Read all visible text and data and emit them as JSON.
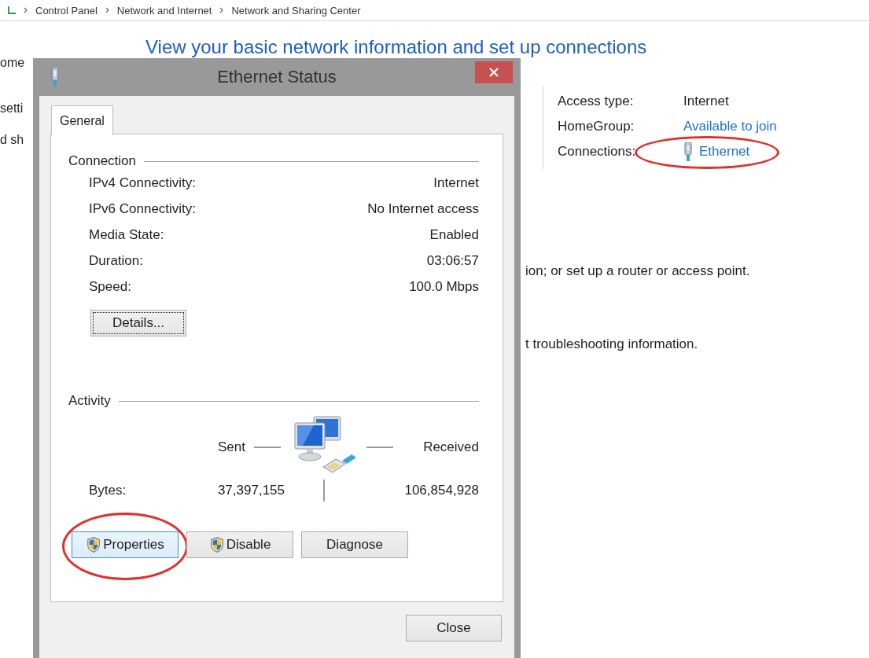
{
  "breadcrumb": [
    "Control Panel",
    "Network and Internet",
    "Network and Sharing Center"
  ],
  "page": {
    "heading": "View your basic network information and set up connections",
    "sidebar_fragments": [
      "ome",
      "setti",
      "d sh"
    ],
    "info": [
      {
        "label": "Access type:",
        "value": "Internet",
        "kind": "text",
        "highlighted": false
      },
      {
        "label": "HomeGroup:",
        "value": "Available to join",
        "kind": "link",
        "highlighted": false
      },
      {
        "label": "Connections:",
        "value": "Ethernet",
        "kind": "connection",
        "highlighted": true
      }
    ],
    "fragments": [
      "ion; or set up a router or access point.",
      "t troubleshooting information."
    ]
  },
  "dialog": {
    "title": "Ethernet Status",
    "tabs": [
      {
        "label": "General",
        "selected": true
      }
    ],
    "connection": {
      "title": "Connection",
      "rows": [
        {
          "label": "IPv4 Connectivity:",
          "value": "Internet"
        },
        {
          "label": "IPv6 Connectivity:",
          "value": "No Internet access"
        },
        {
          "label": "Media State:",
          "value": "Enabled"
        },
        {
          "label": "Duration:",
          "value": "03:06:57"
        },
        {
          "label": "Speed:",
          "value": "100.0 Mbps"
        }
      ]
    },
    "details_button": {
      "label": "Details...",
      "focused": true
    },
    "activity": {
      "title": "Activity",
      "sent": "Sent",
      "received": "Received",
      "bytes_label": "Bytes:",
      "bytes_sent": "37,397,155",
      "bytes_received": "106,854,928"
    },
    "buttons": [
      {
        "label": "Properties",
        "shield": true,
        "highlighted": true
      },
      {
        "label": "Disable",
        "shield": true,
        "highlighted": false
      },
      {
        "label": "Diagnose",
        "shield": false,
        "highlighted": false
      }
    ],
    "close_button": "Close"
  }
}
